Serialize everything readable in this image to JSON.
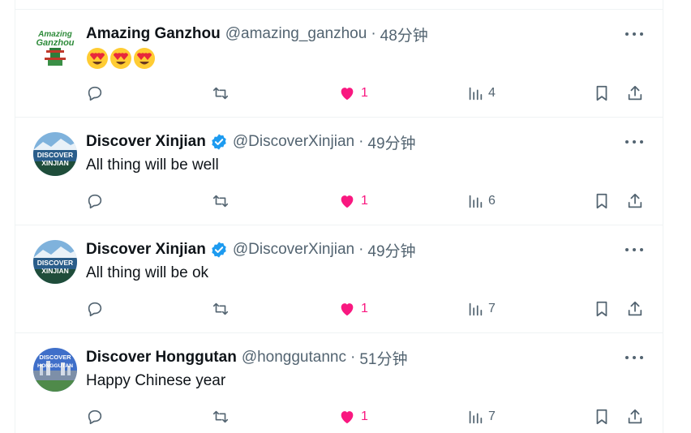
{
  "colors": {
    "like": "#f91880",
    "verified": "#1d9bf0",
    "muted": "#536471",
    "text": "#0f1419",
    "border": "#eff3f4"
  },
  "tweets": [
    {
      "name": "Amazing Ganzhou",
      "handle": "@amazing_ganzhou",
      "separator": "·",
      "time": "48分钟",
      "verified": false,
      "text": "",
      "emoji": [
        "smiling-face-with-heart-eyes",
        "smiling-face-with-heart-eyes",
        "smiling-face-with-heart-eyes"
      ],
      "avatar_label": [
        "Amazing",
        "Ganzhou"
      ],
      "likes": "1",
      "views": "4",
      "liked": true
    },
    {
      "name": "Discover Xinjian",
      "handle": "@DiscoverXinjian",
      "separator": "·",
      "time": "49分钟",
      "verified": true,
      "text": "All thing will be well",
      "avatar_label": [
        "DISCOVER",
        "XINJIAN"
      ],
      "likes": "1",
      "views": "6",
      "liked": true
    },
    {
      "name": "Discover Xinjian",
      "handle": "@DiscoverXinjian",
      "separator": "·",
      "time": "49分钟",
      "verified": true,
      "text": "All thing will be ok",
      "avatar_label": [
        "DISCOVER",
        "XINJIAN"
      ],
      "likes": "1",
      "views": "7",
      "liked": true
    },
    {
      "name": "Discover Honggutan",
      "handle": "@honggutannc",
      "separator": "·",
      "time": "51分钟",
      "verified": false,
      "text": "Happy Chinese year",
      "avatar_label": [
        "DISCOVER",
        "HONGGUTAN"
      ],
      "likes": "1",
      "views": "7",
      "liked": true
    }
  ]
}
